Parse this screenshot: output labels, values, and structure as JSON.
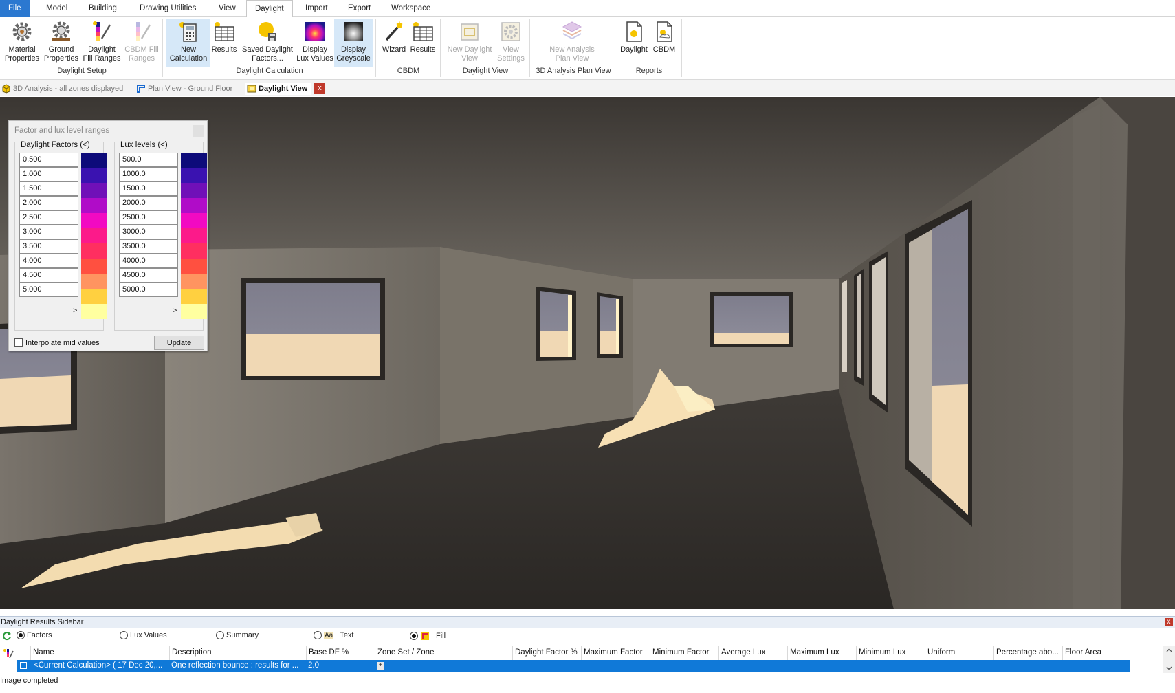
{
  "menu": {
    "tabs": [
      {
        "label": "File"
      },
      {
        "label": "Model"
      },
      {
        "label": "Building"
      },
      {
        "label": "Drawing Utilities"
      },
      {
        "label": "View"
      },
      {
        "label": "Daylight"
      },
      {
        "label": "Import"
      },
      {
        "label": "Export"
      },
      {
        "label": "Workspace"
      }
    ],
    "active": "Daylight"
  },
  "ribbon": {
    "buttons": [
      {
        "line1": "Material",
        "line2": "Properties",
        "icon": "gear-material-icon"
      },
      {
        "line1": "Ground",
        "line2": "Properties",
        "icon": "gear-ground-icon"
      },
      {
        "line1": "Daylight",
        "line2": "Fill Ranges",
        "icon": "fill-ranges-icon"
      },
      {
        "line1": "CBDM Fill",
        "line2": "Ranges",
        "icon": "cbdm-fill-icon"
      },
      {
        "line1": "New",
        "line2": "Calculation",
        "icon": "calculator-icon"
      },
      {
        "line1": "Results",
        "line2": "",
        "icon": "results-table-icon"
      },
      {
        "line1": "Saved Daylight",
        "line2": "Factors...",
        "icon": "saved-factors-icon"
      },
      {
        "line1": "Display",
        "line2": "Lux Values",
        "icon": "lux-values-icon"
      },
      {
        "line1": "Display",
        "line2": "Greyscale",
        "icon": "greyscale-icon"
      },
      {
        "line1": "Wizard",
        "line2": "",
        "icon": "wizard-wand-icon"
      },
      {
        "line1": "Results",
        "line2": "",
        "icon": "cbdm-results-icon"
      },
      {
        "line1": "New Daylight",
        "line2": "View",
        "icon": "new-view-icon"
      },
      {
        "line1": "View",
        "line2": "Settings",
        "icon": "settings-gear-icon"
      },
      {
        "line1": "New Analysis",
        "line2": "Plan View",
        "icon": "layers-icon"
      },
      {
        "line1": "Daylight",
        "line2": "",
        "icon": "report-daylight-icon"
      },
      {
        "line1": "CBDM",
        "line2": "",
        "icon": "report-cbdm-icon"
      }
    ],
    "groups": [
      {
        "label": "Daylight Setup"
      },
      {
        "label": "Daylight Calculation"
      },
      {
        "label": "CBDM"
      },
      {
        "label": "Daylight View"
      },
      {
        "label": "3D Analysis Plan View"
      },
      {
        "label": "Reports"
      }
    ]
  },
  "doc_tabs": [
    {
      "label": "3D Analysis - all zones displayed"
    },
    {
      "label": "Plan View - Ground Floor"
    },
    {
      "label": "Daylight View"
    }
  ],
  "doc_close": "x",
  "panel": {
    "title": "Factor and lux level ranges",
    "df_title": "Daylight Factors  (<)",
    "lux_title": "Lux levels (<)",
    "df_values": [
      "0.500",
      "1.000",
      "1.500",
      "2.000",
      "2.500",
      "3.000",
      "3.500",
      "4.000",
      "4.500",
      "5.000"
    ],
    "lux_values": [
      "500.0",
      "1000.0",
      "1500.0",
      "2000.0",
      "2500.0",
      "3000.0",
      "3500.0",
      "4000.0",
      "4500.0",
      "5000.0"
    ],
    "more": ">",
    "interpolate_label": "Interpolate mid values",
    "update_label": "Update",
    "swatch_colors": [
      "#0d0b7a",
      "#3a12b0",
      "#7010b8",
      "#b00cc8",
      "#f20ac2",
      "#fc1a8a",
      "#ff2f60",
      "#ff5040",
      "#ff9460",
      "#ffd040",
      "#ffffa0"
    ]
  },
  "sidebar": {
    "title": "Daylight Results Sidebar",
    "pin": "⊥",
    "close": "x",
    "options": {
      "factors": "Factors",
      "lux": "Lux Values",
      "summary": "Summary",
      "text_glyph": "Aa",
      "text": "Text",
      "fill": "Fill"
    },
    "columns": [
      "Name",
      "Description",
      "Base DF %",
      "Zone Set / Zone",
      "Daylight Factor %",
      "Maximum Factor",
      "Minimum Factor",
      "Average Lux",
      "Maximum Lux",
      "Minimum Lux",
      "Uniform",
      "Percentage abo...",
      "Floor Area"
    ],
    "row": {
      "name": "<Current Calculation> ( 17 Dec 20,...",
      "description": "One reflection bounce : results for ...",
      "base_df": "2.0",
      "expand": "+"
    }
  },
  "status": "Image completed"
}
